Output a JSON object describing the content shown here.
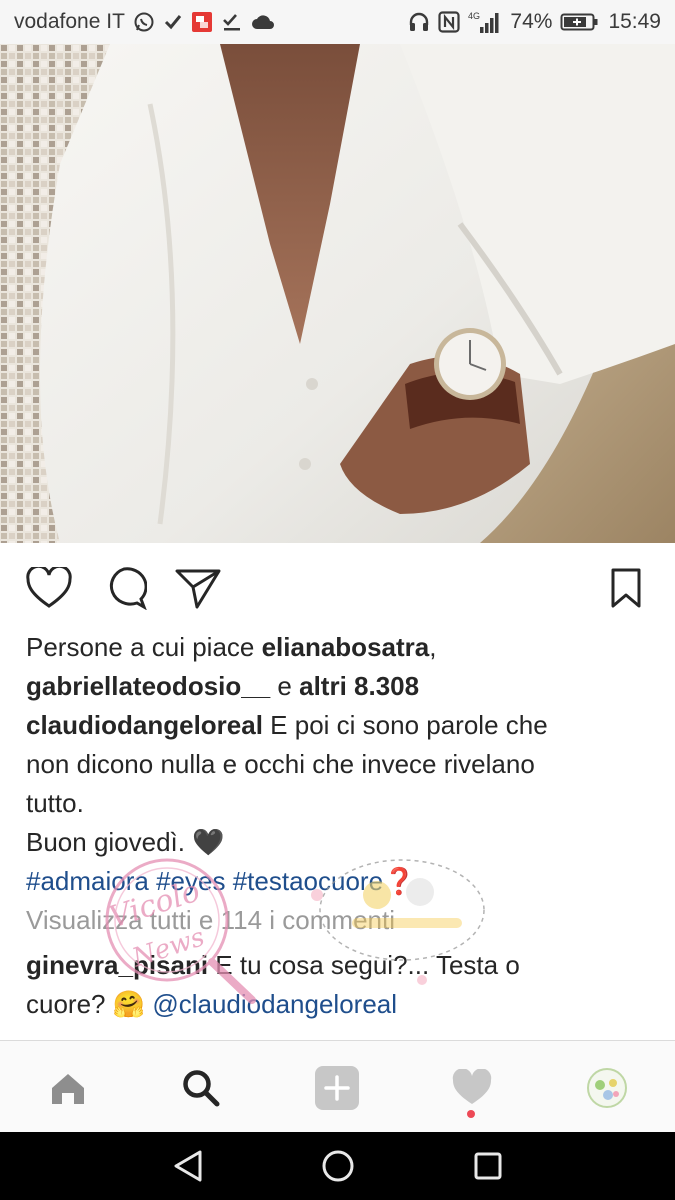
{
  "status_bar": {
    "carrier": "vodafone IT",
    "network": "4G",
    "battery_percent": "74%",
    "time": "15:49",
    "icons": [
      "whatsapp-icon",
      "check-icon",
      "app-notification-icon",
      "task-done-icon",
      "cloud-icon",
      "headset-icon",
      "nfc-icon",
      "signal-icon",
      "battery-icon"
    ]
  },
  "post": {
    "image_subject": "man-in-white-shirt-with-watch",
    "actions": {
      "like": "heart-icon",
      "comment": "comment-icon",
      "share": "send-icon",
      "save": "bookmark-icon"
    },
    "likes": {
      "prefix": "Persone a cui piace ",
      "user1": "elianabosatra",
      "sep": ",",
      "user2": "gabriellateodosio__",
      "middle": " e ",
      "others": "altri 8.308"
    },
    "caption": {
      "author": "claudiodangeloreal",
      "text1": " E poi ci sono parole che",
      "text2": "non dicono nulla e occhi che invece rivelano",
      "text3": "tutto.",
      "text4": "Buon giovedì. ",
      "emoji_heart": "🖤",
      "hashtags": [
        "#admaiora",
        "#eyes",
        "#testaocuore"
      ],
      "emoji_question": "❓"
    },
    "view_comments": "Visualizza tutti e 114 i commenti",
    "comment": {
      "author": "ginevra_pisani",
      "text1": " E tu cosa segui?... Testa o",
      "text2": "cuore? ",
      "emoji": "🤗",
      "mention": "@claudiodangeloreal"
    }
  },
  "watermark": {
    "text": "Vicolo delle News"
  },
  "bottom_nav": [
    "home-icon",
    "search-icon",
    "add-post-icon",
    "activity-heart-icon",
    "profile-avatar"
  ],
  "colors": {
    "hashtag": "#1f4e8c",
    "notification_dot": "#ed4956",
    "muted": "#9a9a9a"
  }
}
